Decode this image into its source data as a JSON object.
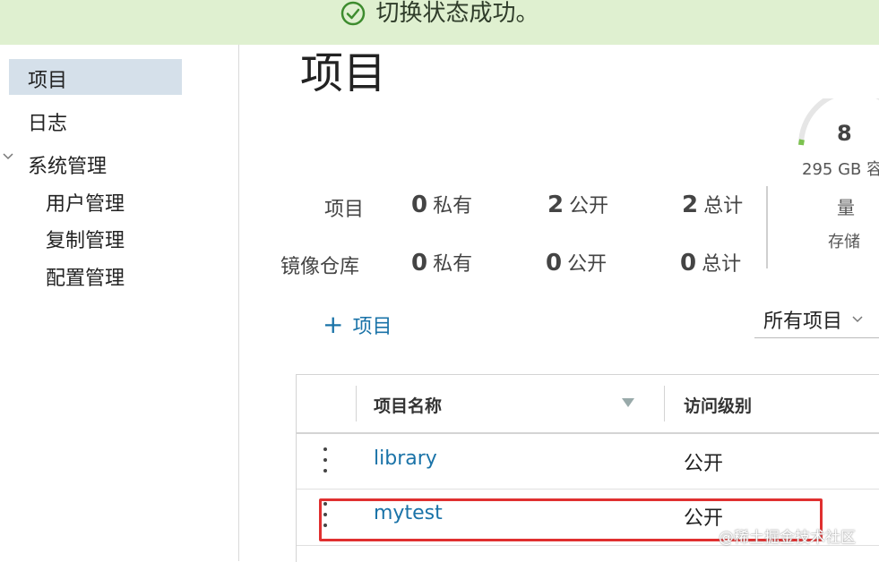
{
  "banner": {
    "message": "切换状态成功。",
    "color": "#dff0d0"
  },
  "sidebar": {
    "items": [
      {
        "label": "项目",
        "active": true
      },
      {
        "label": "日志"
      },
      {
        "label": "系统管理",
        "expanded": true
      }
    ],
    "subitems": [
      {
        "label": "用户管理"
      },
      {
        "label": "复制管理"
      },
      {
        "label": "配置管理"
      }
    ]
  },
  "page": {
    "title": "项目"
  },
  "stats": {
    "rows": [
      {
        "label": "项目",
        "private_count": "0",
        "private_label": "私有",
        "public_count": "2",
        "public_label": "公开",
        "total_count": "2",
        "total_label": "总计"
      },
      {
        "label": "镜像仓库",
        "private_count": "0",
        "private_label": "私有",
        "public_count": "0",
        "public_label": "公开",
        "total_count": "0",
        "total_label": "总计"
      }
    ]
  },
  "storage": {
    "value": "8",
    "capacity": "295 GB 容",
    "label_line1": "量",
    "label_line2": "存储",
    "gauge_color": "#7cc24f"
  },
  "toolbar": {
    "add_label": "项目",
    "filter_value": "所有项目"
  },
  "table": {
    "headers": {
      "name": "项目名称",
      "access": "访问级别"
    },
    "rows": [
      {
        "name": "library",
        "access": "公开"
      },
      {
        "name": "mytest",
        "access": "公开"
      }
    ]
  },
  "watermark": "@稀土掘金技术社区",
  "colors": {
    "link": "#1a73a8",
    "highlight": "#e03030",
    "active_nav": "#d5e0ea"
  }
}
